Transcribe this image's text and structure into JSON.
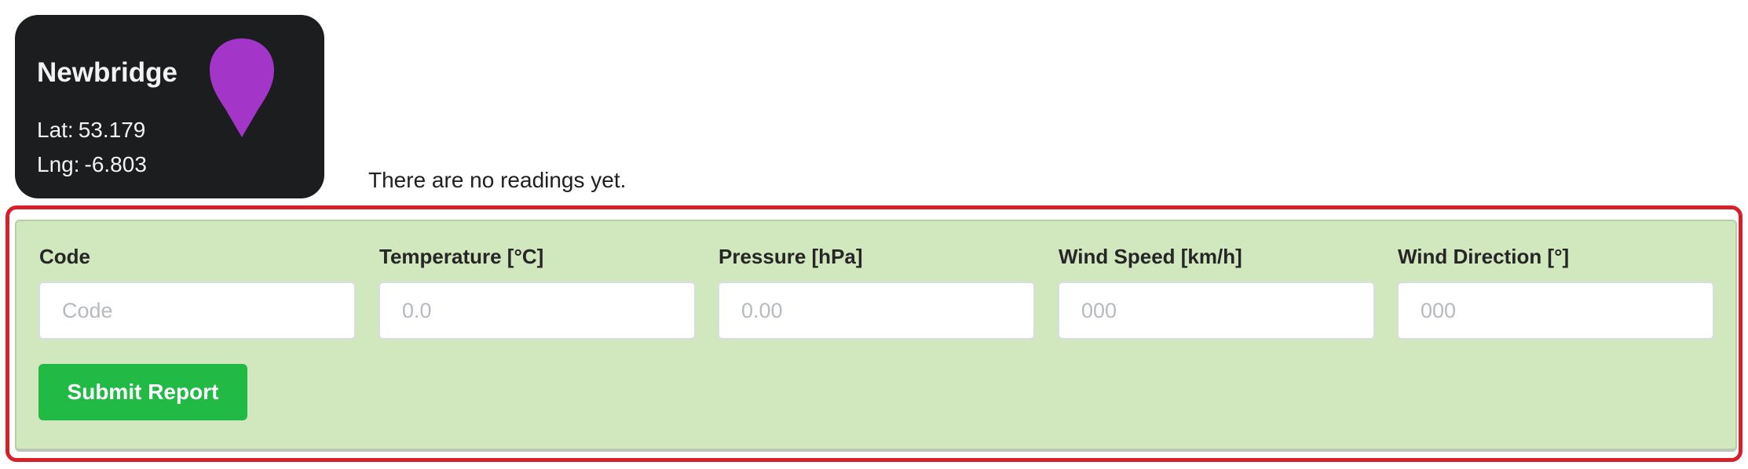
{
  "station": {
    "name": "Newbridge",
    "lat_label": "Lat:",
    "lat": "53.179",
    "lng_label": "Lng:",
    "lng": "-6.803",
    "icon": "map-pin-icon",
    "icon_color": "#a335c9"
  },
  "readings": {
    "empty_message": "There are no readings yet."
  },
  "form": {
    "fields": [
      {
        "label": "Code",
        "value": "",
        "placeholder": "Code"
      },
      {
        "label": "Temperature [°C]",
        "value": "",
        "placeholder": "0.0"
      },
      {
        "label": "Pressure [hPa]",
        "value": "",
        "placeholder": "0.00"
      },
      {
        "label": "Wind Speed [km/h]",
        "value": "",
        "placeholder": "000"
      },
      {
        "label": "Wind Direction [°]",
        "value": "",
        "placeholder": "000"
      }
    ],
    "submit_label": "Submit Report"
  },
  "colors": {
    "card_background": "#1c1d1f",
    "form_background": "#d1e7be",
    "submit_button": "#21ba45",
    "highlight": "#d9202a"
  }
}
